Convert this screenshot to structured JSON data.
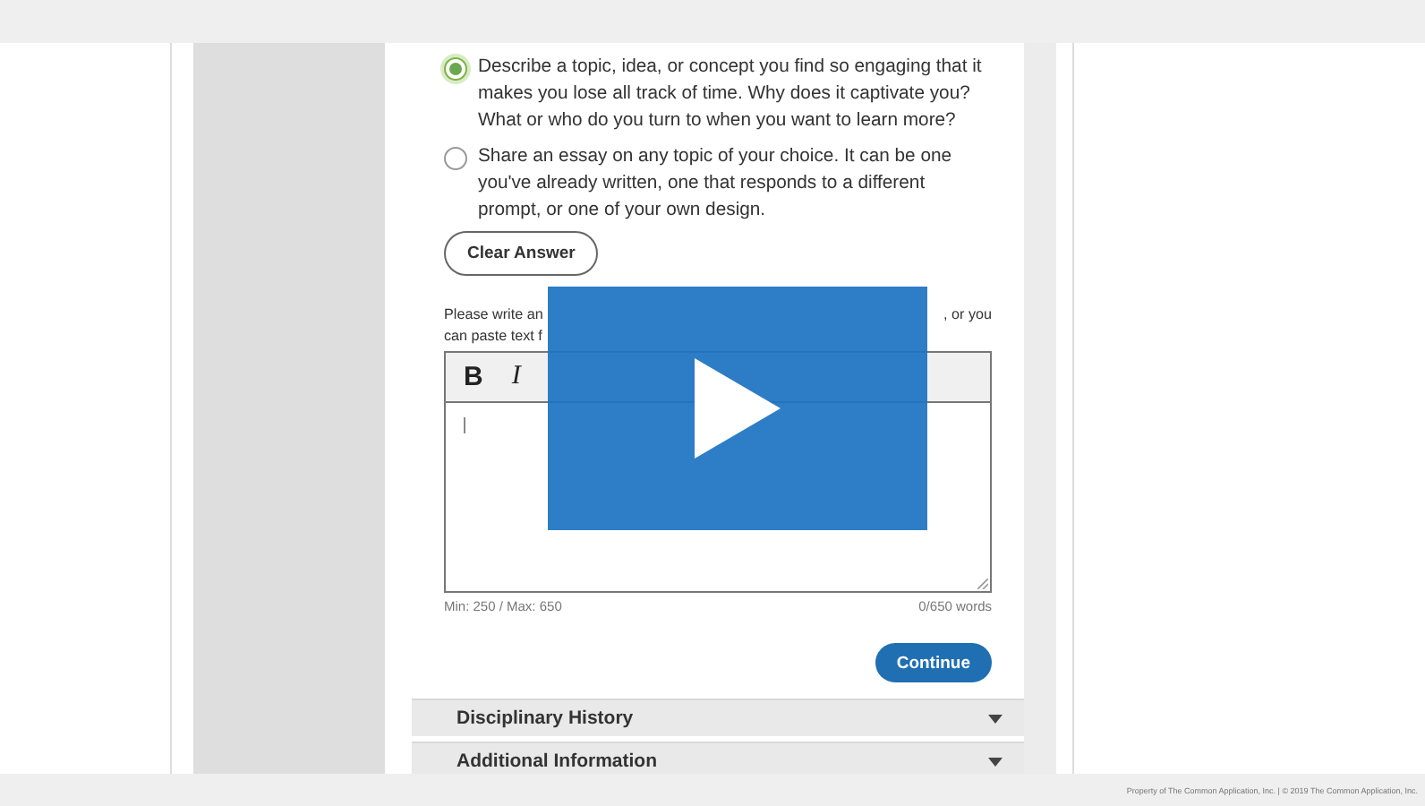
{
  "prompts": [
    {
      "text": "Describe a topic, idea, or concept you find so engaging that it makes you lose all track of time. Why does it captivate you? What or who do you turn to when you want to learn more?",
      "selected": true
    },
    {
      "text": "Share an essay on any topic of your choice. It can be one you've already written, one that responds to a different prompt, or one of your own design.",
      "selected": false
    }
  ],
  "clear_button": "Clear Answer",
  "instructions": {
    "start": "Please write an",
    "end": ", or you",
    "second_line": "can paste text f"
  },
  "editor": {
    "toolbar": [
      {
        "kind": "bold",
        "label": "B"
      },
      {
        "kind": "italic",
        "label": "I"
      }
    ]
  },
  "word_limits": "Min: 250 / Max: 650",
  "word_count": "0/650 words",
  "continue_button": "Continue",
  "sections": [
    {
      "title": "Disciplinary History",
      "expanded": false
    },
    {
      "title": "Additional Information",
      "expanded": false
    }
  ],
  "footer": "Property of The Common Application, Inc. | © 2019 The Common Application, Inc."
}
